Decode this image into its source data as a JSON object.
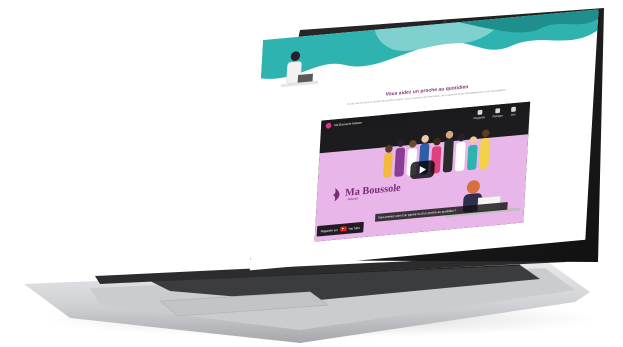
{
  "page": {
    "heading": "Vous aidez un proche au quotidien",
    "intro": "Ce site internet vient en soutien des proches aidants. Vous y trouverez de l'information, des ressources et des témoignages pour vous accompagner."
  },
  "video": {
    "title": "Ma Boussole Aidants",
    "controls": [
      {
        "label": "Regarder",
        "icon": "clock-icon"
      },
      {
        "label": "Partager",
        "icon": "share-icon"
      },
      {
        "label": "Info",
        "icon": "info-icon"
      }
    ],
    "brand_name": "Ma Boussole",
    "brand_sub": "Aidants",
    "caption": "Vous prenez soin d'un parent ou d'un proche au quotidien ?",
    "watch_on_label": "Regarder sur",
    "watch_on_platform": "YouTube"
  },
  "colors": {
    "teal": "#2fb3b0",
    "purple": "#7b2c78",
    "pink": "#e9b6ea",
    "laptop_silver": "#d9dadc"
  }
}
